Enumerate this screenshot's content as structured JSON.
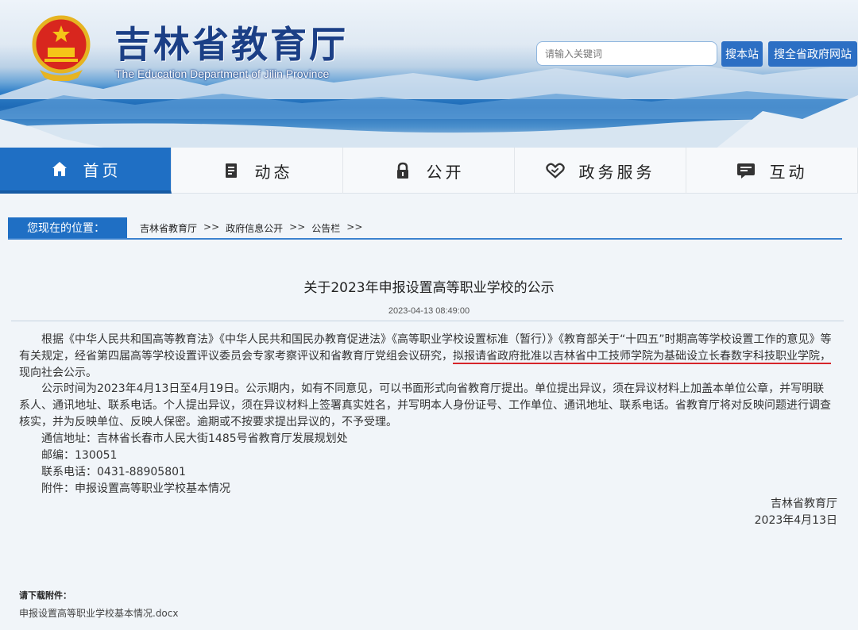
{
  "header": {
    "title": "吉林省教育厅",
    "subtitle": "The Education Department of Jilin Province",
    "search_placeholder": "请输入关键词",
    "search_site_label": "搜本站",
    "search_province_label": "搜全省政府网站"
  },
  "nav": {
    "items": [
      {
        "label": "首页",
        "icon": "home-icon",
        "active": true
      },
      {
        "label": "动态",
        "icon": "news-icon",
        "active": false
      },
      {
        "label": "公开",
        "icon": "lock-icon",
        "active": false
      },
      {
        "label": "政务服务",
        "icon": "handshake-icon",
        "active": false
      },
      {
        "label": "互动",
        "icon": "chat-icon",
        "active": false
      }
    ]
  },
  "breadcrumb": {
    "tag": "您现在的位置：",
    "items": [
      "吉林省教育厅",
      "政府信息公开",
      "公告栏"
    ],
    "separator": ">>"
  },
  "article": {
    "title": "关于2023年申报设置高等职业学校的公示",
    "date": "2023-04-13 08:49:00",
    "para1_a": "根据《中华人民共和国高等教育法》《中华人民共和国民办教育促进法》《高等职业学校设置标准（暂行）》《教育部关于“十四五”时期高等学校设置工作的意见》等有关规定，经省第四届高等学校设置评议委员会专家考察评议和省教育厅党组会议研究，",
    "para1_highlight": "拟报请省政府批准以吉林省中工技师学院为基础设立长春数字科技职业学院，",
    "para1_b": "现向社会公示。",
    "para2": "公示时间为2023年4月13日至4月19日。公示期内，如有不同意见，可以书面形式向省教育厅提出。单位提出异议，须在异议材料上加盖本单位公章，并写明联系人、通讯地址、联系电话。个人提出异议，须在异议材料上签署真实姓名，并写明本人身份证号、工作单位、通讯地址、联系电话。省教育厅将对反映问题进行调查核实，并为反映单位、反映人保密。逾期或不按要求提出异议的，不予受理。",
    "address": "通信地址：吉林省长春市人民大街1485号省教育厅发展规划处",
    "postcode": "邮编：130051",
    "phone": "联系电话：0431-88905801",
    "attachment": "附件：申报设置高等职业学校基本情况",
    "sign_org": "吉林省教育厅",
    "sign_date": "2023年4月13日"
  },
  "downloads": {
    "label": "请下载附件：",
    "file": "申报设置高等职业学校基本情况.docx"
  },
  "colors": {
    "primary_blue": "#1f6fc4",
    "title_blue": "#1b3f86",
    "highlight_red": "#d6242a"
  }
}
